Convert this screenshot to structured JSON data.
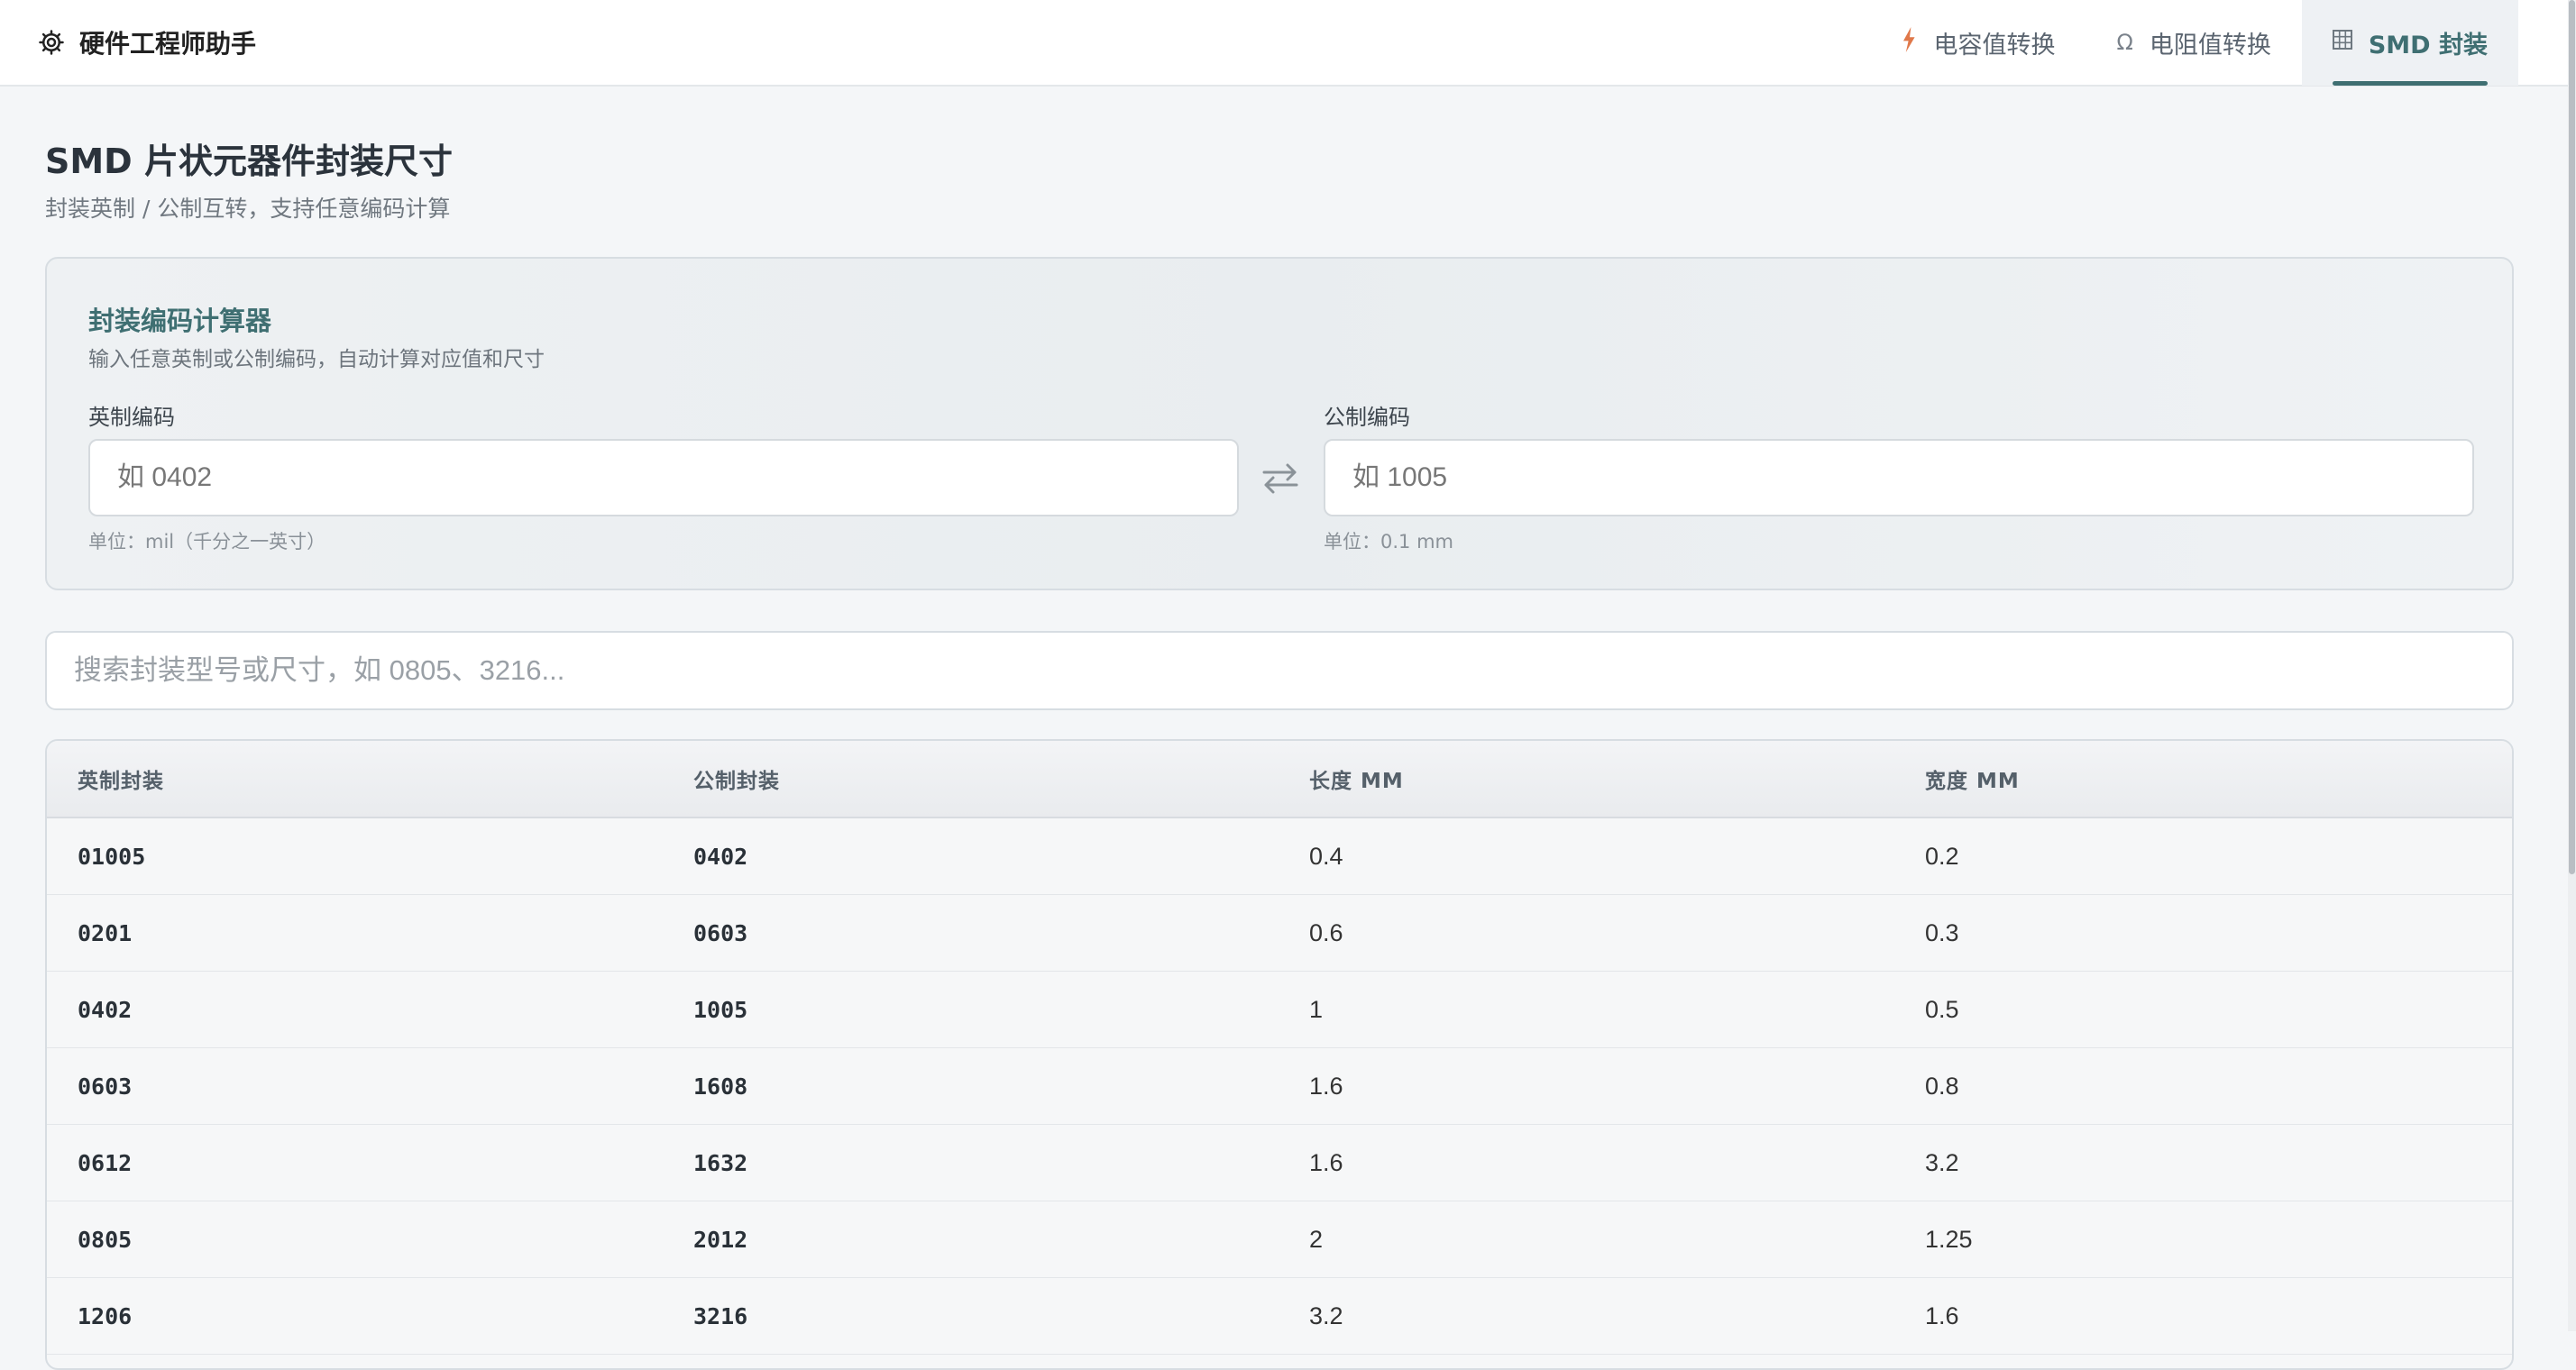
{
  "app": {
    "title": "硬件工程师助手",
    "icon": "gear-icon"
  },
  "nav": {
    "tabs": [
      {
        "label": "电容值转换",
        "icon": "bolt-icon",
        "active": false
      },
      {
        "label": "电阻值转换",
        "icon": "omega-icon",
        "active": false
      },
      {
        "label": "SMD 封装",
        "icon": "grid-icon",
        "active": true
      }
    ]
  },
  "page": {
    "title": "SMD 片状元器件封装尺寸",
    "subtitle": "封装英制 / 公制互转，支持任意编码计算"
  },
  "calculator": {
    "title": "封装编码计算器",
    "description": "输入任意英制或公制编码，自动计算对应值和尺寸",
    "imperial": {
      "label": "英制编码",
      "placeholder": "如 0402",
      "value": "",
      "hint": "单位：mil（千分之一英寸）"
    },
    "metric": {
      "label": "公制编码",
      "placeholder": "如 1005",
      "value": "",
      "hint": "单位：0.1 mm"
    }
  },
  "search": {
    "placeholder": "搜索封装型号或尺寸，如 0805、3216...",
    "value": ""
  },
  "table": {
    "headers": [
      "英制封装",
      "公制封装",
      "长度 MM",
      "宽度 MM"
    ],
    "rows": [
      [
        "01005",
        "0402",
        "0.4",
        "0.2"
      ],
      [
        "0201",
        "0603",
        "0.6",
        "0.3"
      ],
      [
        "0402",
        "1005",
        "1",
        "0.5"
      ],
      [
        "0603",
        "1608",
        "1.6",
        "0.8"
      ],
      [
        "0612",
        "1632",
        "1.6",
        "3.2"
      ],
      [
        "0805",
        "2012",
        "2",
        "1.25"
      ],
      [
        "1206",
        "3216",
        "3.2",
        "1.6"
      ]
    ]
  },
  "colors": {
    "accent": "#3f6f72",
    "bolt": "#e0784a",
    "background": "#f4f6f8"
  }
}
